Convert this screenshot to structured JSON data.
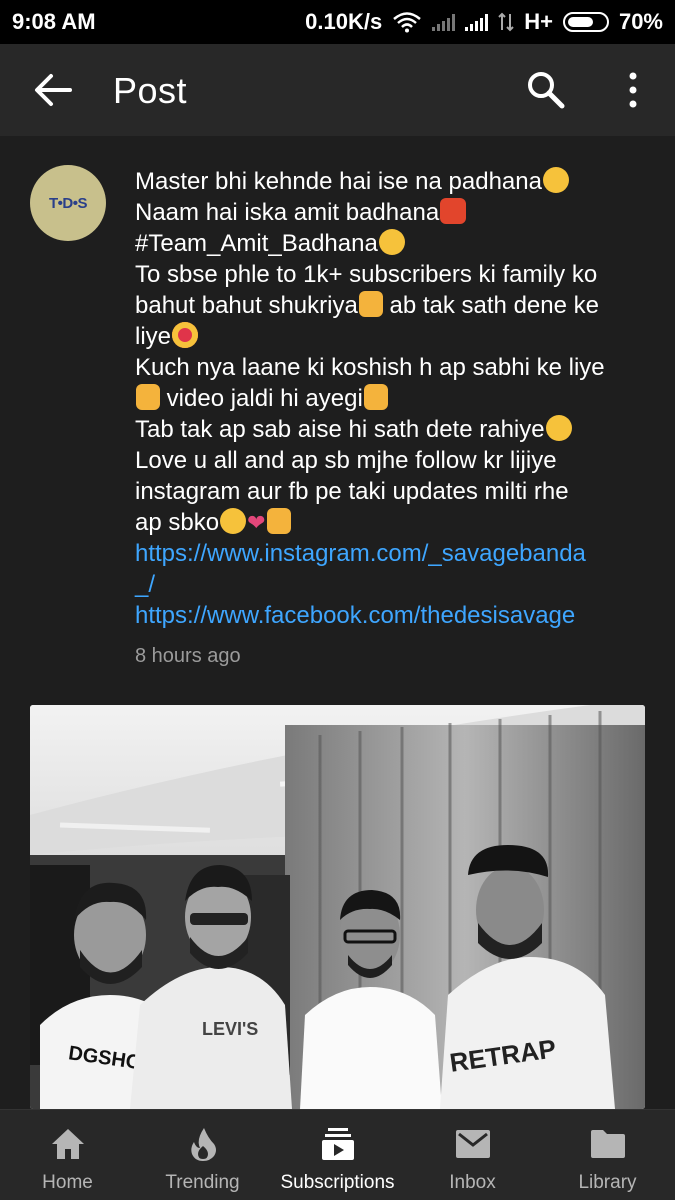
{
  "status": {
    "time": "9:08 AM",
    "speed": "0.10K/s",
    "network": "H+",
    "battery": "70%",
    "battery_level": 0.7
  },
  "app_bar": {
    "title": "Post",
    "back_icon": "arrow-back-icon",
    "search_icon": "search-icon",
    "more_icon": "more-vert-icon"
  },
  "post": {
    "channel_avatar_text": "T•D•S",
    "lines": [
      "Master bhi kehnde hai ise na padhana",
      "Naam hai iska amit badhana",
      "#Team_Amit_Badhana",
      "To sbse phle to 1k+ subscribers ki family ko",
      "bahut bahut shukriya",
      " ab tak sath dene ke",
      "liye",
      "Kuch nya laane ki koshish h ap sabhi ke liye",
      " video jaldi hi ayegi",
      "Tab tak ap sab aise hi sath dete rahiye",
      "Love u all and ap sb mjhe follow kr lijiye",
      "instagram aur fb pe taki updates milti rhe",
      "ap sbko"
    ],
    "links": [
      "https://www.instagram.com/_savagebanda",
      "_/",
      "https://www.facebook.com/thedesisavage"
    ],
    "timestamp": "8 hours ago",
    "image_text": {
      "shirt_1": "DGSHOEED",
      "shirt_2": "LEVI'S",
      "shirt_4": "RETRAP"
    }
  },
  "bottom_nav": [
    {
      "label": "Home",
      "icon": "home-icon"
    },
    {
      "label": "Trending",
      "icon": "flame-icon"
    },
    {
      "label": "Subscriptions",
      "icon": "subscriptions-icon",
      "active": true
    },
    {
      "label": "Inbox",
      "icon": "mail-icon"
    },
    {
      "label": "Library",
      "icon": "folder-icon"
    }
  ]
}
